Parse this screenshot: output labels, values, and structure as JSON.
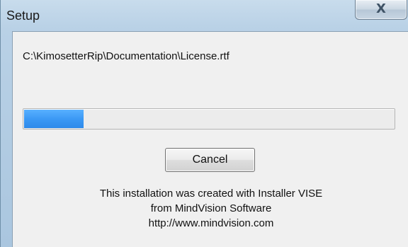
{
  "window": {
    "title": "Setup",
    "close_label": "X"
  },
  "installer": {
    "current_file": "C:\\KimosetterRip\\Documentation\\License.rtf",
    "progress_percent": 16,
    "cancel_label": "Cancel",
    "credits": [
      "This installation was created with Installer VISE",
      "from MindVision Software",
      "http://www.mindvision.com"
    ]
  },
  "colors": {
    "progress_fill": "#3c99f5",
    "client_bg": "#f0f0f0"
  }
}
